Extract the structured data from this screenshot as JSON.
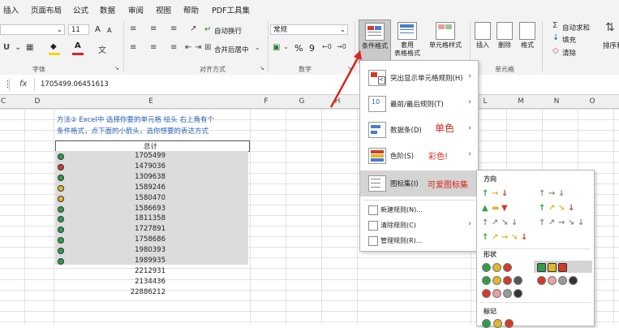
{
  "menubar": {
    "items": [
      "插入",
      "页面布局",
      "公式",
      "数据",
      "审阅",
      "视图",
      "帮助",
      "PDF工具集"
    ]
  },
  "ribbon": {
    "font_size": "11",
    "font_grow": "A",
    "font_shrink": "A",
    "wrap_label": "自动换行",
    "merge_label": "合并后居中",
    "number_format": "常规",
    "percent": "%",
    "comma": "9",
    "cond_format_label": "条件格式",
    "table_format_label": "套用\n表格格式",
    "cell_style_label": "单元格样式",
    "insert_label": "插入",
    "delete_label": "删除",
    "format_label": "格式",
    "autosum_label": "自动求和",
    "fill_label": "填充",
    "clear_label": "清除",
    "sort_label": "排序和",
    "group_font": "字体",
    "group_align": "对齐方式",
    "group_number": "数字",
    "group_cells": "单元格"
  },
  "formula": {
    "fx": "fx",
    "value": "1705499.06451613"
  },
  "columns": [
    "C",
    "D",
    "E",
    "F",
    "G",
    "H",
    "L",
    "M",
    "N",
    "O"
  ],
  "sheet": {
    "note_line1": "方法② Excel中 选择你要的单元格 绘头 右上角有个",
    "note_line2": "条件格式，点下面的小箭头，选你想要的表达方式",
    "header": "总计",
    "values": [
      "1705499",
      "1479036",
      "1309638",
      "1589246",
      "1580470",
      "1586693",
      "1811358",
      "1727891",
      "1758686",
      "1980393",
      "1989935",
      "2212931",
      "2134436",
      "22886212"
    ],
    "icon_colors": [
      "#2e9e4a",
      "#d23b2b",
      "#2e9e4a",
      "#e3b62a",
      "#e3b62a",
      "#2e9e4a",
      "#2e9e4a",
      "#2e9e4a",
      "#2e9e4a",
      "#2e9e4a",
      "#2e9e4a"
    ]
  },
  "cfmenu": {
    "items": [
      {
        "label": "突出显示单元格规则(H)",
        "note": ""
      },
      {
        "label": "最前/最后规则(T)",
        "note": ""
      },
      {
        "label": "数据条(D)",
        "note": "单色"
      },
      {
        "label": "色阶(S)",
        "note": "彩色!"
      },
      {
        "label": "图标集(I)",
        "note": "可爱图标集"
      }
    ],
    "small_items": [
      "新建规则(N)...",
      "清除规则(C)",
      "管理规则(R)..."
    ]
  },
  "submenu": {
    "heading_direction": "方向",
    "heading_shape": "形状",
    "heading_mark": "标记"
  },
  "colors": {
    "accent": "#217346",
    "highlight_red": "#d9261c",
    "arrow_green": "#2e9e4a",
    "arrow_yellow": "#e3b62a",
    "arrow_red": "#d23b2b",
    "arrow_gray": "#8a8a8a"
  }
}
